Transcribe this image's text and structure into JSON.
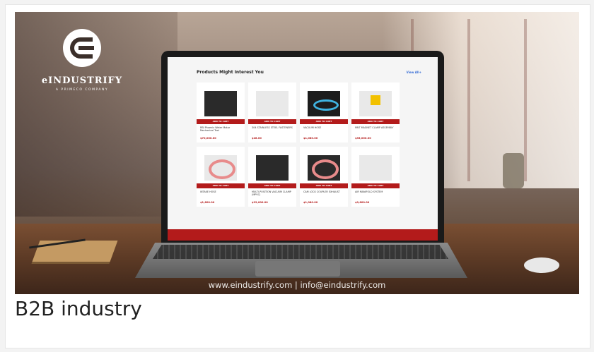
{
  "brand": {
    "name": "eINDUSTRIFY",
    "tagline": "A PRIMECO COMPANY"
  },
  "screen": {
    "section_title": "Products Might Interest You",
    "view_all": "View All+",
    "products": [
      {
        "name": "RBI Phoenix Water Motor Mechanical Tool",
        "price": "$70,000.00",
        "button": "ADD TO CART",
        "image": "power-tool-image"
      },
      {
        "name": "304 STAINLESS STEEL FASTENERS",
        "price": "$28.00",
        "button": "ADD TO CART",
        "image": "fasteners-image"
      },
      {
        "name": "VACUUM HOSE",
        "price": "$1,080.00",
        "button": "ADD TO CART",
        "image": "blue-hose-image"
      },
      {
        "name": "MNT MAGNET CLAMP ASSEMBLY",
        "price": "$35,000.00",
        "button": "ADD TO CART",
        "image": "magnet-clamp-image"
      },
      {
        "name": "INTAKE HOSE",
        "price": "$1,600.00",
        "button": "ADD TO CART",
        "image": "pink-hose-image"
      },
      {
        "name": "MULTI-POSITION VACUUM CLAMP (MPVC)",
        "price": "$22,000.00",
        "button": "ADD TO CART",
        "image": "vacuum-clamp-image"
      },
      {
        "name": "CAM LOCK COUPLER EXHAUST",
        "price": "$1,080.00",
        "button": "ADD TO CART",
        "image": "coupler-hose-image"
      },
      {
        "name": "AIR MANIFOLD SYSTEM",
        "price": "$9,600.00",
        "button": "ADD TO CART",
        "image": "manifold-image"
      }
    ]
  },
  "footer_contact": "www.eindustrify.com | info@eindustrify.com",
  "caption": "B2B industry"
}
